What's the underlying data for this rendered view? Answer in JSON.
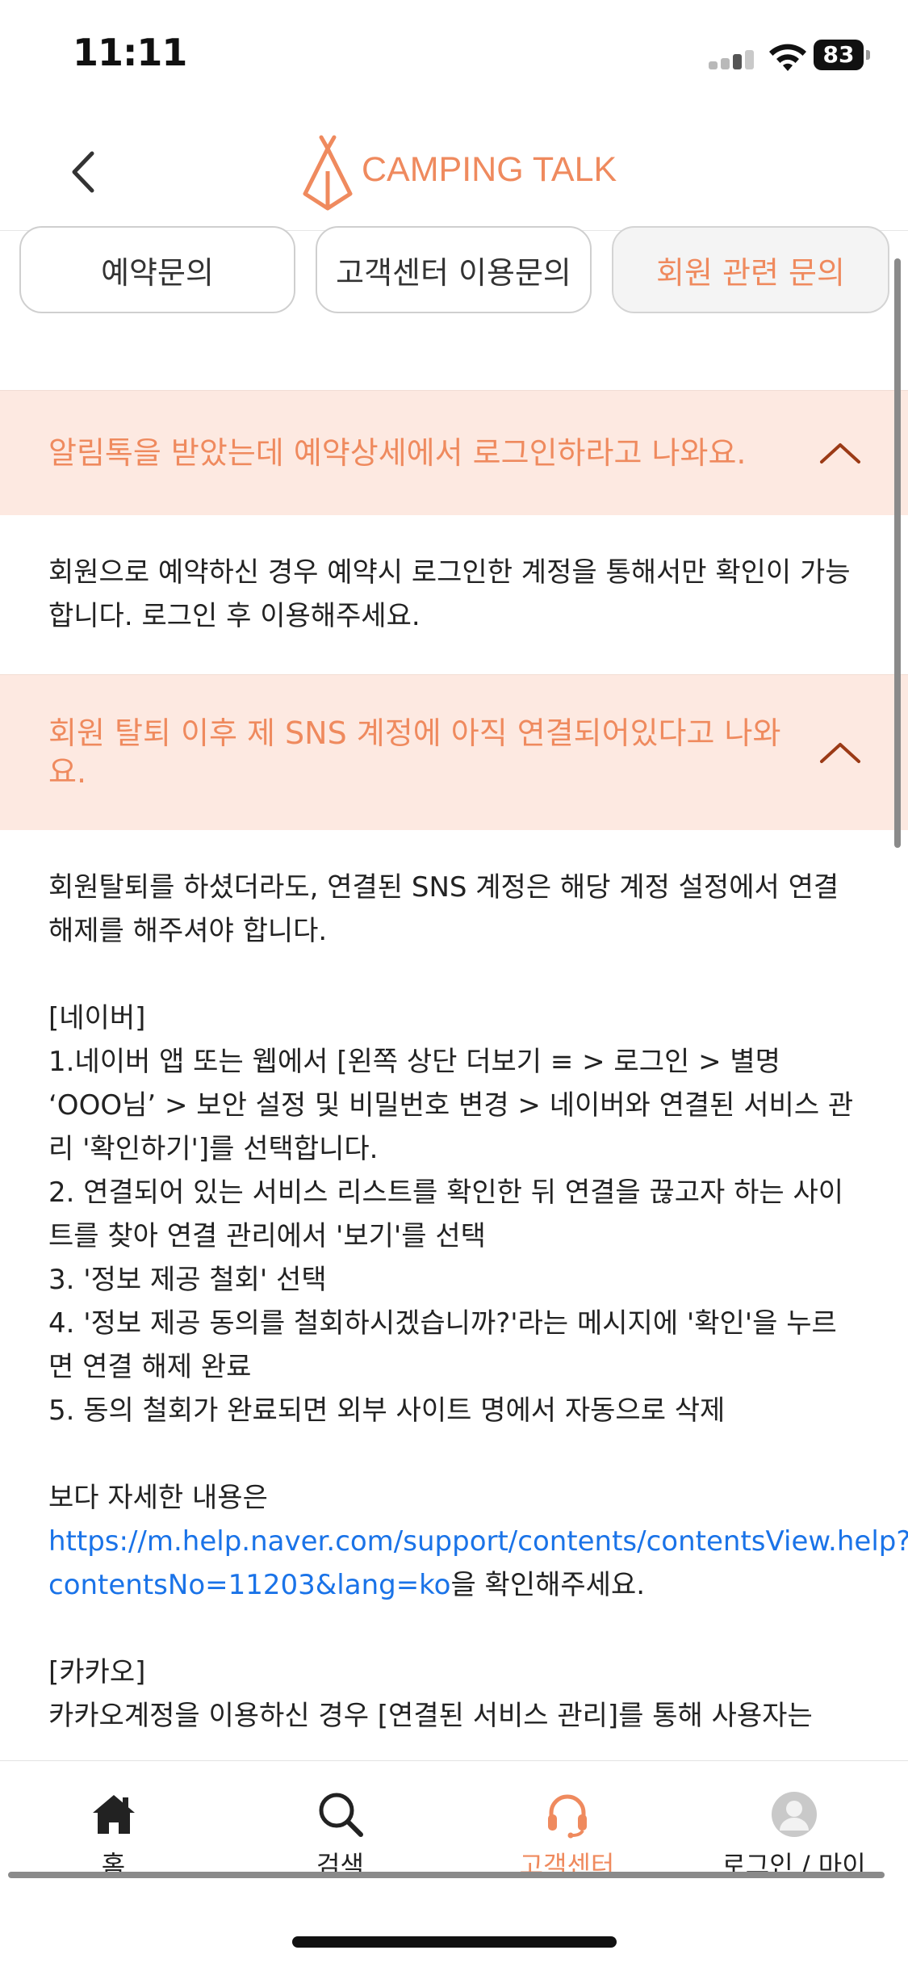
{
  "status": {
    "time": "11:11",
    "battery": "83"
  },
  "header": {
    "logo_text": "CAMPING TALK"
  },
  "chips": [
    {
      "label": "예약문의"
    },
    {
      "label": "고객센터 이용문의"
    },
    {
      "label": "회원 관련 문의"
    }
  ],
  "active_chip": "회원 관련 문의",
  "faq": [
    {
      "question": "알림톡을 받았는데 예약상세에서 로그인하라고 나와요.",
      "answer": "회원으로 예약하신 경우 예약시 로그인한 계정을 통해서만 확인이 가능합니다. 로그인 후 이용해주세요."
    },
    {
      "question": "회원 탈퇴 이후 제 SNS 계정에 아직 연결되어있다고 나와요.",
      "answer": {
        "intro": "회원탈퇴를 하셨더라도, 연결된 SNS 계정은 해당 계정 설정에서 연결해제를 해주셔야 합니다.",
        "naver_title": "[네이버]",
        "step1": "1.네이버 앱 또는 웹에서 [왼쪽 상단 더보기 ≡ > 로그인 > 별명 ‘OOO님’ > 보안 설정 및 비밀번호 변경 > 네이버와 연결된 서비스 관리 '확인하기']를 선택합니다.",
        "step2": "2. 연결되어 있는 서비스 리스트를 확인한 뒤 연결을 끊고자 하는 사이트를 찾아 연결 관리에서 '보기'를 선택",
        "step3": "3. '정보 제공 철회' 선택",
        "step4": "4. '정보 제공 동의를 철회하시겠습니까?'라는 메시지에 '확인'을 누르면 연결 해제 완료",
        "step5": "5. 동의 철회가 완료되면 외부 사이트 명에서 자동으로 삭제",
        "more_text": "보다 자세한 내용은",
        "link_line1": "https://m.help.naver.com/support/contents/contentsView.help?",
        "link_line2": "contentsNo=11203&lang=ko",
        "link_suffix": "을 확인해주세요.",
        "kakao_title": "[카카오]",
        "kakao_text": "카카오계정을 이용하신 경우 [연결된 서비스 관리]를 통해 사용자는"
      }
    }
  ],
  "bottom_nav": [
    {
      "label": "홈",
      "icon": "home-icon"
    },
    {
      "label": "검색",
      "icon": "search-icon"
    },
    {
      "label": "고객센터",
      "icon": "headset-icon"
    },
    {
      "label": "로그인 / 마이",
      "icon": "profile-icon"
    }
  ],
  "colors": {
    "accent": "#ef8a5e",
    "question_bg": "#fde9e1",
    "link": "#1a73e8"
  }
}
